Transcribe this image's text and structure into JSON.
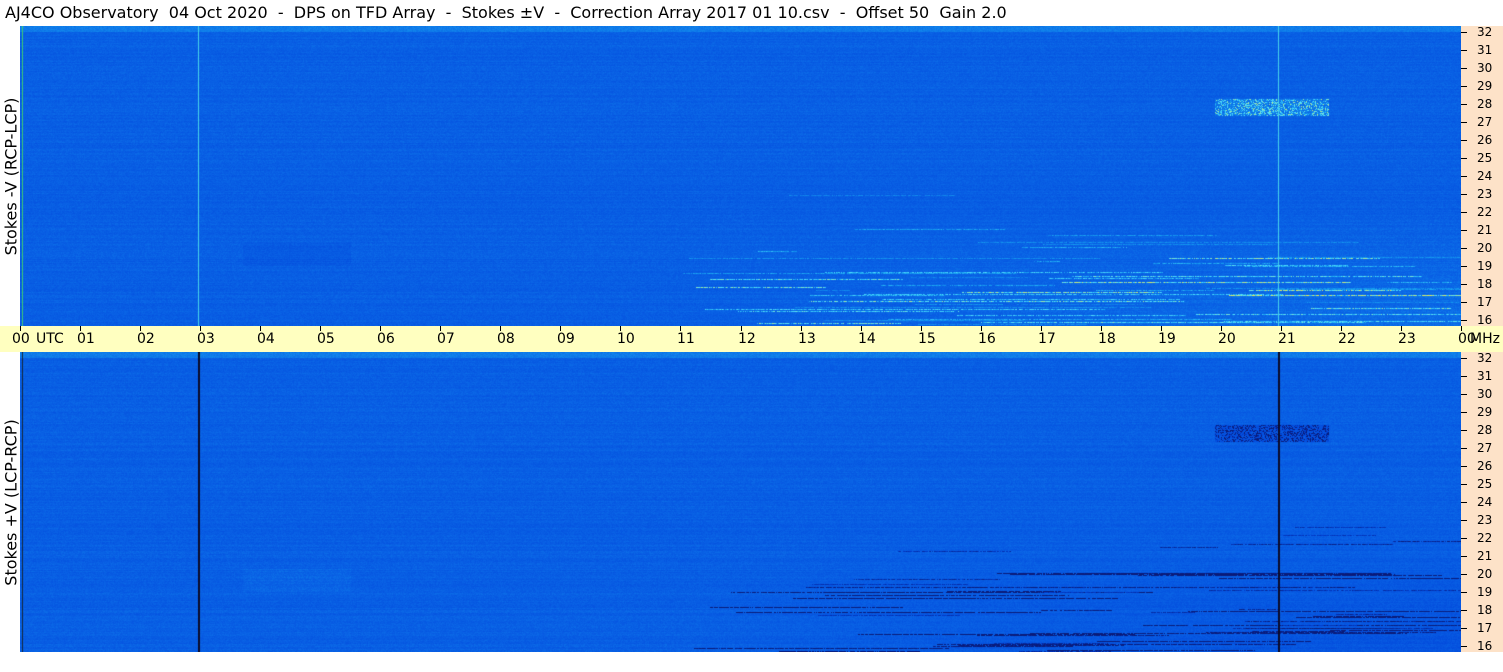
{
  "header": {
    "title": "AJ4CO Observatory  04 Oct 2020  -  DPS on TFD Array  -  Stokes ±V  -  Correction Array 2017 01 10.csv  -  Offset 50  Gain 2.0"
  },
  "chart_data": [
    {
      "type": "heatmap",
      "ylabel": "Stokes -V (RCP-LCP)",
      "ylim": [
        16,
        32
      ],
      "xlim": [
        0,
        24
      ],
      "intensity": "bright",
      "colormap": [
        "#0a1a78",
        "#0040d8",
        "#0a64e6",
        "#16a0f0",
        "#55e6ff",
        "#f0f050"
      ]
    },
    {
      "type": "heatmap",
      "ylabel": "Stokes +V (LCP-RCP)",
      "ylim": [
        16,
        32
      ],
      "xlim": [
        0,
        24
      ],
      "intensity": "dark",
      "colormap": [
        "#0a1a78",
        "#0040d8",
        "#0a64e6",
        "#16a0f0",
        "#55e6ff",
        "#f0f050"
      ]
    }
  ],
  "time_axis": {
    "labels": [
      "00",
      "01",
      "02",
      "03",
      "04",
      "05",
      "06",
      "07",
      "08",
      "09",
      "10",
      "11",
      "12",
      "13",
      "14",
      "15",
      "16",
      "17",
      "18",
      "19",
      "20",
      "21",
      "22",
      "23",
      "00"
    ],
    "unit_label": "UTC",
    "end_unit": "MHz"
  },
  "freq_axis": {
    "labels": [
      "32",
      "31",
      "30",
      "29",
      "28",
      "27",
      "26",
      "25",
      "24",
      "23",
      "22",
      "21",
      "20",
      "19",
      "18",
      "17",
      "16"
    ]
  }
}
